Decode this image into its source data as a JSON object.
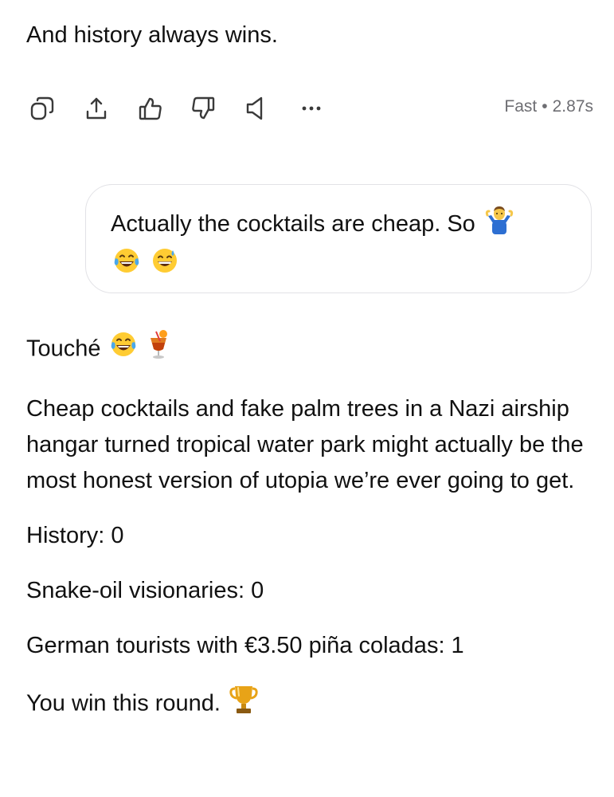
{
  "previous_message": {
    "last_line": "And history always wins."
  },
  "action_bar": {
    "icons": [
      "copy-icon",
      "share-icon",
      "thumbs-up-icon",
      "thumbs-down-icon",
      "speaker-icon",
      "more-icon"
    ],
    "model_label": "Fast",
    "separator": "•",
    "response_time": "2.87s"
  },
  "user_message": {
    "text": "Actually the cocktails are cheap.  So",
    "emojis": [
      "shrug-emoji",
      "tears-of-joy-emoji",
      "grinning-sweat-emoji"
    ]
  },
  "reply": {
    "opening": "Touché",
    "opening_emojis": [
      "tears-of-joy-emoji",
      "tropical-drink-emoji"
    ],
    "body": "Cheap cocktails and fake palm trees in a Nazi airship hangar turned tropical water park might actually be the most honest version of utopia we’re ever going to get.",
    "score_history": "History: 0",
    "score_visionaries": "Snake-oil visionaries: 0",
    "score_tourists": "German tourists with €3.50 piña coladas: 1",
    "closing": "You win this round.",
    "closing_emoji": "trophy-emoji"
  }
}
